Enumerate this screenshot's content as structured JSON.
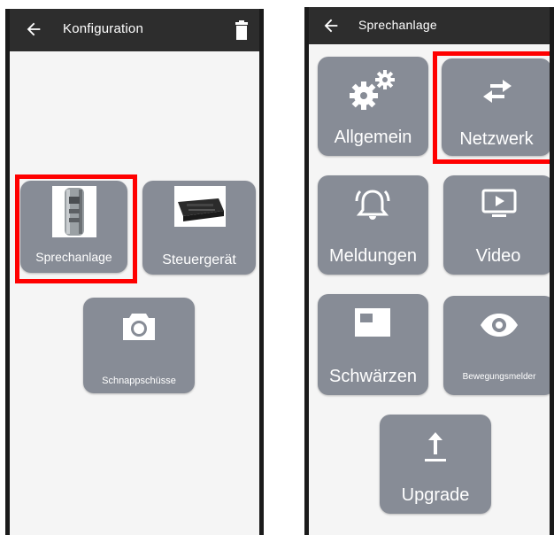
{
  "left_screen": {
    "title": "Konfiguration",
    "tiles": [
      {
        "label": "Sprechanlage",
        "icon": "intercom-device-image"
      },
      {
        "label": "Steuergerät",
        "icon": "controller-device-image"
      },
      {
        "label": "Schnappschüsse",
        "icon": "camera-icon"
      }
    ],
    "highlighted": "Sprechanlage"
  },
  "right_screen": {
    "title": "Sprechanlage",
    "tiles": [
      {
        "label": "Allgemein",
        "icon": "gears-icon"
      },
      {
        "label": "Netzwerk",
        "icon": "swap-arrows-icon"
      },
      {
        "label": "Meldungen",
        "icon": "bell-ringing-icon"
      },
      {
        "label": "Video",
        "icon": "video-play-icon"
      },
      {
        "label": "Schwärzen",
        "icon": "mask-window-icon"
      },
      {
        "label": "Bewegungsmelder",
        "icon": "eye-icon"
      },
      {
        "label": "Upgrade",
        "icon": "upload-icon"
      }
    ],
    "highlighted": "Netzwerk"
  },
  "colors": {
    "appbar": "#2d2d2d",
    "tile": "#878c96",
    "highlight": "#ff0000",
    "screen_bg": "#f5f5f5"
  }
}
